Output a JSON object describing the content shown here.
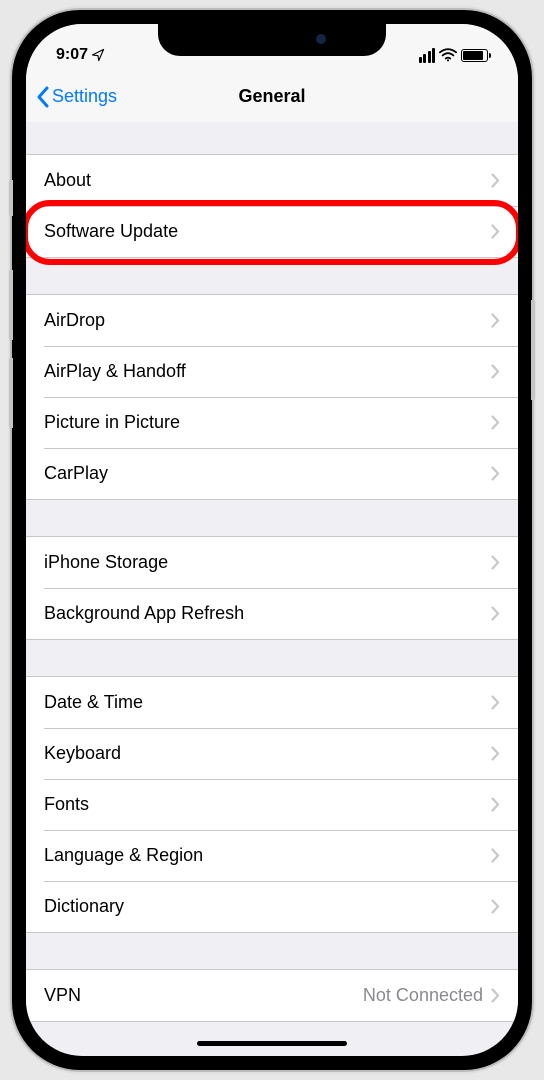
{
  "status": {
    "time": "9:07"
  },
  "nav": {
    "back": "Settings",
    "title": "General"
  },
  "group1": [
    {
      "label": "About"
    },
    {
      "label": "Software Update",
      "highlight": true
    }
  ],
  "group2": [
    {
      "label": "AirDrop"
    },
    {
      "label": "AirPlay & Handoff"
    },
    {
      "label": "Picture in Picture"
    },
    {
      "label": "CarPlay"
    }
  ],
  "group3": [
    {
      "label": "iPhone Storage"
    },
    {
      "label": "Background App Refresh"
    }
  ],
  "group4": [
    {
      "label": "Date & Time"
    },
    {
      "label": "Keyboard"
    },
    {
      "label": "Fonts"
    },
    {
      "label": "Language & Region"
    },
    {
      "label": "Dictionary"
    }
  ],
  "group5": [
    {
      "label": "VPN",
      "detail": "Not Connected"
    }
  ]
}
